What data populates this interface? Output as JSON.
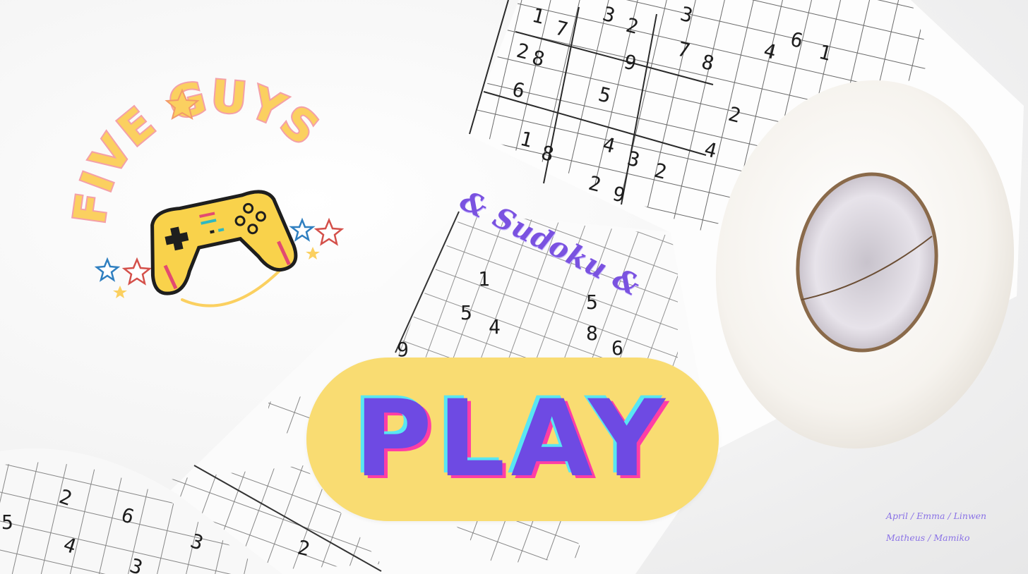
{
  "logo": {
    "text": "FIVE GUYS",
    "colors": {
      "letters": "#fbd060",
      "outline": "#f4a0a8",
      "controller": "#f9d24b",
      "controller_edge": "#1e1e1e"
    },
    "icons": [
      "controller-icon",
      "star-icon"
    ]
  },
  "tagline": "& Sudoku &",
  "play_button": {
    "label": "PLAY",
    "bg": "#f9dc72",
    "text_color": "#6e4ae3"
  },
  "credits": {
    "line1": "April / Emma / Linwen",
    "line2": "Matheus / Mamiko"
  },
  "sudoku": {
    "roll_top_digits": [
      "1",
      "7",
      "3",
      "2",
      "3",
      "2",
      "8",
      "9",
      "7",
      "8",
      "4",
      "6",
      "1",
      "6",
      "5",
      "2",
      "1",
      "8",
      "4",
      "3",
      "2",
      "4",
      "2",
      "9"
    ],
    "paper_digits": [
      "1",
      "5",
      "4",
      "5",
      "8",
      "6",
      "9"
    ],
    "bottom_roll_digits": [
      "5",
      "2",
      "6",
      "4",
      "3",
      "3",
      "2"
    ]
  }
}
